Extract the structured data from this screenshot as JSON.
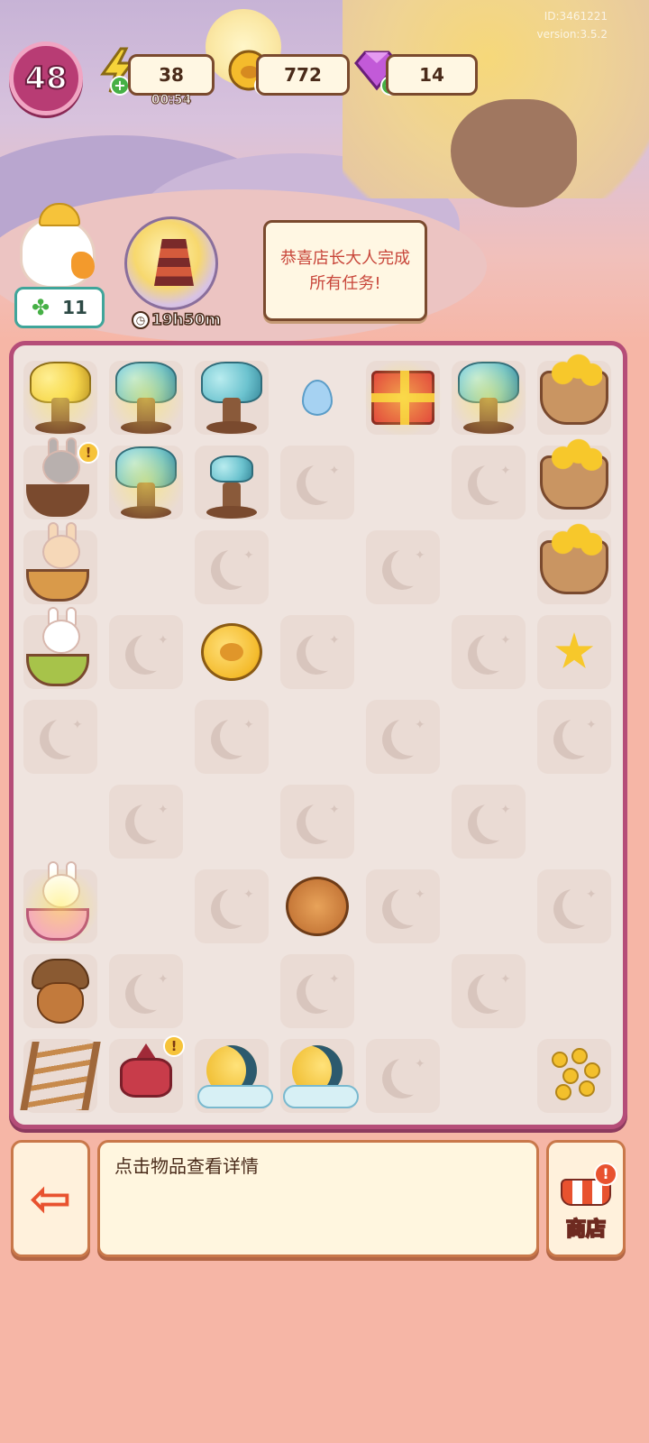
{
  "hud": {
    "level": "48",
    "energy": {
      "value": "38",
      "timer": "00:54",
      "icon": "lightning-icon"
    },
    "coins": {
      "value": "772",
      "icon": "coin-icon"
    },
    "gems": {
      "value": "14",
      "icon": "gem-icon"
    },
    "watermark_line1": "ID:3461221",
    "watermark_line2": "version:3.5.2"
  },
  "task_helper": {
    "stars": "11",
    "icon": "clover-icon"
  },
  "event": {
    "timer": "19h50m",
    "icon": "pagoda-event-icon"
  },
  "speech_text": "恭喜店长大人完成所有任务!",
  "board": {
    "rows": [
      [
        {
          "item": "gold-tree",
          "bolt": true
        },
        {
          "item": "blue-tree",
          "bolt": true
        },
        {
          "item": "blue-tree"
        },
        {
          "item": "crystal",
          "tile": false
        },
        {
          "item": "gift",
          "bolt": true
        },
        {
          "item": "pagoda-tree",
          "bolt": true
        },
        {
          "item": "star-platter"
        }
      ],
      [
        {
          "item": "bunny-gray",
          "excl": true
        },
        {
          "item": "blue-tree",
          "bolt": true
        },
        {
          "item": "sprout"
        },
        {
          "item": null
        },
        {
          "item": null,
          "tile": false
        },
        {
          "item": null
        },
        {
          "item": "star-basket"
        }
      ],
      [
        {
          "item": "bunny-pink"
        },
        {
          "item": null,
          "tile": false
        },
        {
          "item": null
        },
        {
          "item": null,
          "tile": false
        },
        {
          "item": null
        },
        {
          "item": null,
          "tile": false
        },
        {
          "item": "star-table"
        }
      ],
      [
        {
          "item": "bunny-green"
        },
        {
          "item": null
        },
        {
          "item": "coin",
          "tile": false
        },
        {
          "item": null
        },
        {
          "item": null,
          "tile": false
        },
        {
          "item": null
        },
        {
          "item": "star"
        }
      ],
      [
        {
          "item": null
        },
        {
          "item": null,
          "tile": false
        },
        {
          "item": null
        },
        {
          "item": null,
          "tile": false
        },
        {
          "item": null
        },
        {
          "item": null,
          "tile": false
        },
        {
          "item": null
        }
      ],
      [
        {
          "item": null,
          "tile": false
        },
        {
          "item": null
        },
        {
          "item": null,
          "tile": false
        },
        {
          "item": null
        },
        {
          "item": null,
          "tile": false
        },
        {
          "item": null
        },
        {
          "item": null,
          "tile": false
        }
      ],
      [
        {
          "item": "bunny-rainbow",
          "bolt": true
        },
        {
          "item": null,
          "tile": false
        },
        {
          "item": null
        },
        {
          "item": "mooncake",
          "tile": false
        },
        {
          "item": null
        },
        {
          "item": null,
          "tile": false
        },
        {
          "item": null
        }
      ],
      [
        {
          "item": "acorn"
        },
        {
          "item": null
        },
        {
          "item": null,
          "tile": false
        },
        {
          "item": null
        },
        {
          "item": null,
          "tile": false
        },
        {
          "item": null
        },
        {
          "item": null,
          "tile": false
        }
      ],
      [
        {
          "item": "ladder"
        },
        {
          "item": "lantern",
          "excl": true
        },
        {
          "item": "moon-cloud"
        },
        {
          "item": "moon-cloud"
        },
        {
          "item": null
        },
        {
          "item": null,
          "tile": false
        },
        {
          "item": "osmanthus"
        }
      ]
    ]
  },
  "info_text": "点击物品查看详情",
  "shop_label": "商店",
  "exit_icon": "exit-door-icon",
  "colors": {
    "board_border": "#b54d78",
    "level_badge": "#b83c74",
    "panel_border": "#c9784a",
    "accent_red": "#e8522f"
  }
}
